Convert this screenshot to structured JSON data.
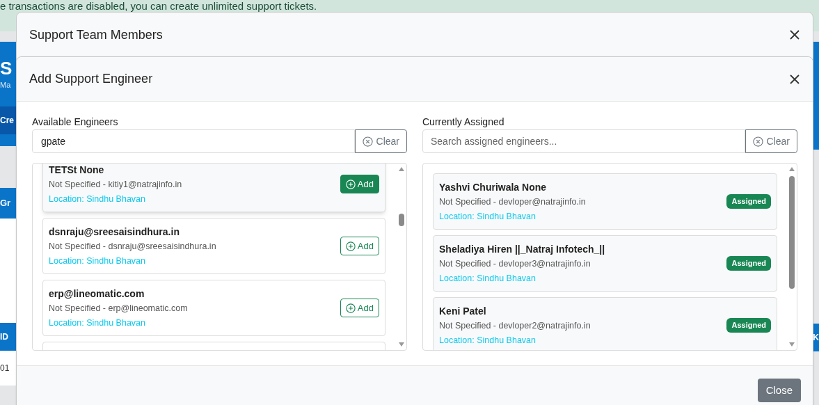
{
  "background": {
    "banner_text": "e transactions are disabled, you can create unlimited support tickets.",
    "header_title": "S",
    "header_subtitle": "Ma",
    "create_button": "Cre",
    "tab": "Gr",
    "table_header": "ID",
    "table_cell": "01",
    "right_header": "K"
  },
  "outer_modal": {
    "title": "Support Team Members"
  },
  "modal": {
    "title": "Add Support Engineer",
    "available": {
      "label": "Available Engineers",
      "search_value": "gpate",
      "clear": "Clear",
      "engineers": [
        {
          "name": "TETSt None",
          "detail": "Not Specified - kitiy1@natrajinfo.in",
          "location": "Location: Sindhu Bhavan",
          "action": "Add",
          "highlighted": true
        },
        {
          "name": "dsnraju@sreesaisindhura.in",
          "detail": "Not Specified - dsnraju@sreesaisindhura.in",
          "location": "Location: Sindhu Bhavan",
          "action": "Add",
          "highlighted": false
        },
        {
          "name": "erp@lineomatic.com",
          "detail": "Not Specified - erp@lineomatic.com",
          "location": "Location: Sindhu Bhavan",
          "action": "Add",
          "highlighted": false
        }
      ]
    },
    "assigned": {
      "label": "Currently Assigned",
      "placeholder": "Search assigned engineers...",
      "clear": "Clear",
      "engineers": [
        {
          "name": "Yashvi Churiwala None",
          "detail": "Not Specified - devloper@natrajinfo.in",
          "location": "Location: Sindhu Bhavan",
          "badge": "Assigned"
        },
        {
          "name": "Sheladiya Hiren ||_Natraj Infotech_||",
          "detail": "Not Specified - devloper3@natrajinfo.in",
          "location": "Location: Sindhu Bhavan",
          "badge": "Assigned"
        },
        {
          "name": "Keni Patel",
          "detail": "Not Specified - devloper2@natrajinfo.in",
          "location": "Location: Sindhu Bhavan",
          "badge": "Assigned"
        }
      ]
    },
    "close": "Close"
  }
}
